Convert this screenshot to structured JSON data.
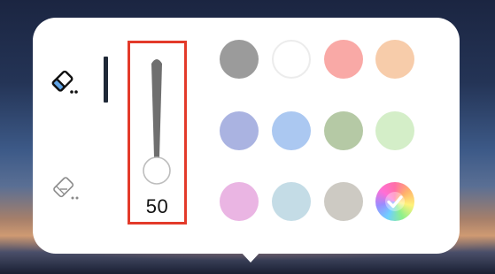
{
  "pen_popup": {
    "tools": [
      {
        "name": "eraser",
        "icon": "eraser-icon",
        "selected": true
      },
      {
        "name": "selection-eraser",
        "icon": "selection-eraser-icon",
        "selected": false
      }
    ],
    "size_slider": {
      "value": "50",
      "highlight_color": "#e33a2a"
    },
    "colors": [
      {
        "name": "gray",
        "hex": "#9b9b9b"
      },
      {
        "name": "white",
        "hex": "#ffffff"
      },
      {
        "name": "salmon",
        "hex": "#f9a9a6"
      },
      {
        "name": "peach",
        "hex": "#f7ccaa"
      },
      {
        "name": "periwinkle",
        "hex": "#aab3e1"
      },
      {
        "name": "light-blue",
        "hex": "#abc8f1"
      },
      {
        "name": "sage",
        "hex": "#b5c9a5"
      },
      {
        "name": "mint",
        "hex": "#d4eec8"
      },
      {
        "name": "orchid",
        "hex": "#eab5e3"
      },
      {
        "name": "powder-blue",
        "hex": "#c4dce6"
      },
      {
        "name": "stone",
        "hex": "#cdcac3"
      },
      {
        "name": "custom-palette",
        "icon": "rainbow-palette-icon",
        "selected": true
      }
    ]
  }
}
